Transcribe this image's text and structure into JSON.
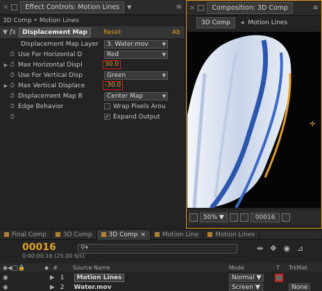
{
  "effect_panel": {
    "tab_title": "Effect Controls: Motion Lines",
    "breadcrumb": "3D Comp • Motion Lines",
    "effect_name": "Displacement Map",
    "reset_label": "Reset",
    "about_label": "Ab",
    "properties": [
      {
        "label": "Displacement Map Layer",
        "kind": "dropdown",
        "value": "3. Water.mov"
      },
      {
        "label": "Use For Horizontal D",
        "kind": "dropdown",
        "value": "Red"
      },
      {
        "label": "Max Horizontal Displ",
        "kind": "value",
        "value": "30.0"
      },
      {
        "label": "Use For Vertical Disp",
        "kind": "dropdown",
        "value": "Green"
      },
      {
        "label": "Max Vertical Displace",
        "kind": "value",
        "value": "-30.0"
      },
      {
        "label": "Displacement Map B",
        "kind": "dropdown",
        "value": "Center Map"
      },
      {
        "label": "Edge Behavior",
        "kind": "checkbox",
        "value": "Wrap Pixels Arou"
      },
      {
        "label": "",
        "kind": "checkbox",
        "value": "Expand Output"
      }
    ]
  },
  "comp_panel": {
    "tab_title": "Composition: 3D Comp",
    "subtabs": [
      "3D Comp",
      "Motion Lines"
    ],
    "zoom": "50%",
    "frame": "00016"
  },
  "timeline": {
    "tabs": [
      "Final Comp",
      "3D Comp",
      "3D Comp",
      "Motion Line",
      "Motion Lines"
    ],
    "active_tab": 2,
    "timecode": "00016",
    "fps": "0:00:00:16 (25.00 fps)",
    "search_placeholder": "",
    "col_source": "Source Name",
    "col_mode": "Mode",
    "col_t": "T",
    "col_trkmat": "TrkMat",
    "layers": [
      {
        "num": "1",
        "name": "Motion Lines",
        "mode": "Normal"
      },
      {
        "num": "2",
        "name": "Water.mov",
        "mode": "Screen",
        "trkmat": "None"
      }
    ]
  }
}
